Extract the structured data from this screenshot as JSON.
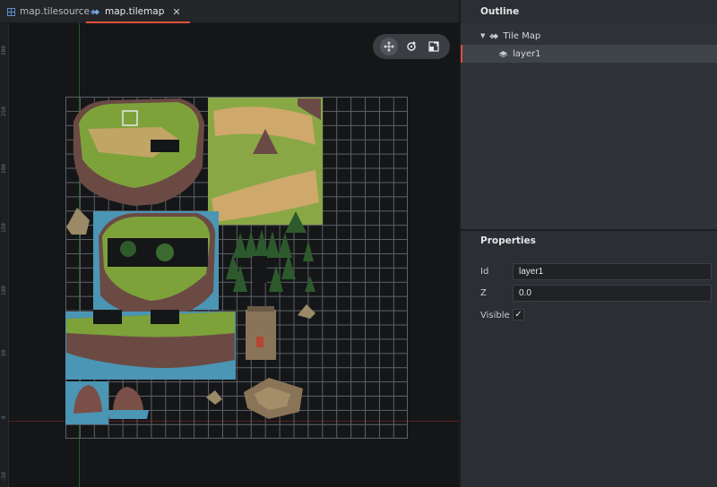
{
  "tabs": [
    {
      "label": "map.tilesource",
      "icon": "tileset-icon"
    },
    {
      "label": "map.tilemap",
      "icon": "tilemap-icon",
      "close": "✕"
    }
  ],
  "ruler": {
    "labels": [
      "300",
      "250",
      "200",
      "150",
      "100",
      "50",
      "0",
      "-50"
    ]
  },
  "toolbar": {
    "tools": [
      "move-tool-icon",
      "rotate-tool-icon",
      "scale-tool-icon"
    ]
  },
  "outline": {
    "title": "Outline",
    "items": [
      {
        "label": "Tile Map",
        "icon": "tilemap-icon"
      },
      {
        "label": "layer1",
        "icon": "layer-icon"
      }
    ]
  },
  "properties": {
    "title": "Properties",
    "id_label": "Id",
    "id_value": "layer1",
    "z_label": "Z",
    "z_value": "0.0",
    "visible_label": "Visible",
    "visible_checked": "✓"
  },
  "colors": {
    "accent": "#e0503c",
    "panel": "#2b2e32",
    "viewport": "#151618"
  }
}
